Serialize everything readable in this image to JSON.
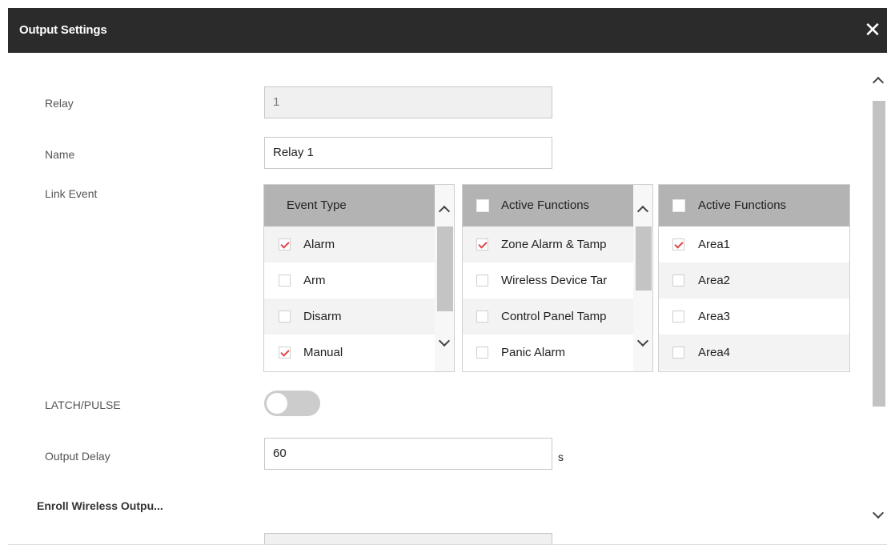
{
  "dialog": {
    "title": "Output Settings",
    "close_glyph": "✕"
  },
  "form": {
    "relay_label": "Relay",
    "relay_value": "1",
    "name_label": "Name",
    "name_value": "Relay 1",
    "link_event_label": "Link Event",
    "latch_label": "LATCH/PULSE",
    "latch_on": false,
    "output_delay_label": "Output Delay",
    "output_delay_value": "60",
    "output_delay_unit": "s",
    "enroll_label": "Enroll Wireless Outpu..."
  },
  "event_panel": {
    "header": "Event Type",
    "items": [
      {
        "label": "Alarm",
        "checked": true
      },
      {
        "label": "Arm",
        "checked": false
      },
      {
        "label": "Disarm",
        "checked": false
      },
      {
        "label": "Manual",
        "checked": true
      }
    ]
  },
  "functions_panel": {
    "header": "Active Functions",
    "items": [
      {
        "label": "Zone Alarm & Tamp",
        "checked": true
      },
      {
        "label": "Wireless Device Tar",
        "checked": false
      },
      {
        "label": "Control Panel Tamp",
        "checked": false
      },
      {
        "label": "Panic Alarm",
        "checked": false
      }
    ]
  },
  "areas_panel": {
    "header": "Active Functions",
    "items": [
      {
        "label": "Area1",
        "checked": true
      },
      {
        "label": "Area2",
        "checked": false
      },
      {
        "label": "Area3",
        "checked": false
      },
      {
        "label": "Area4",
        "checked": false
      }
    ]
  },
  "colors": {
    "titlebar": "#2b2b2b",
    "header": "#b3b3b3",
    "check": "#e0454a"
  },
  "icons": {
    "close": "close-icon",
    "scroll_up": "chevron-up-icon",
    "scroll_down": "chevron-down-icon"
  }
}
